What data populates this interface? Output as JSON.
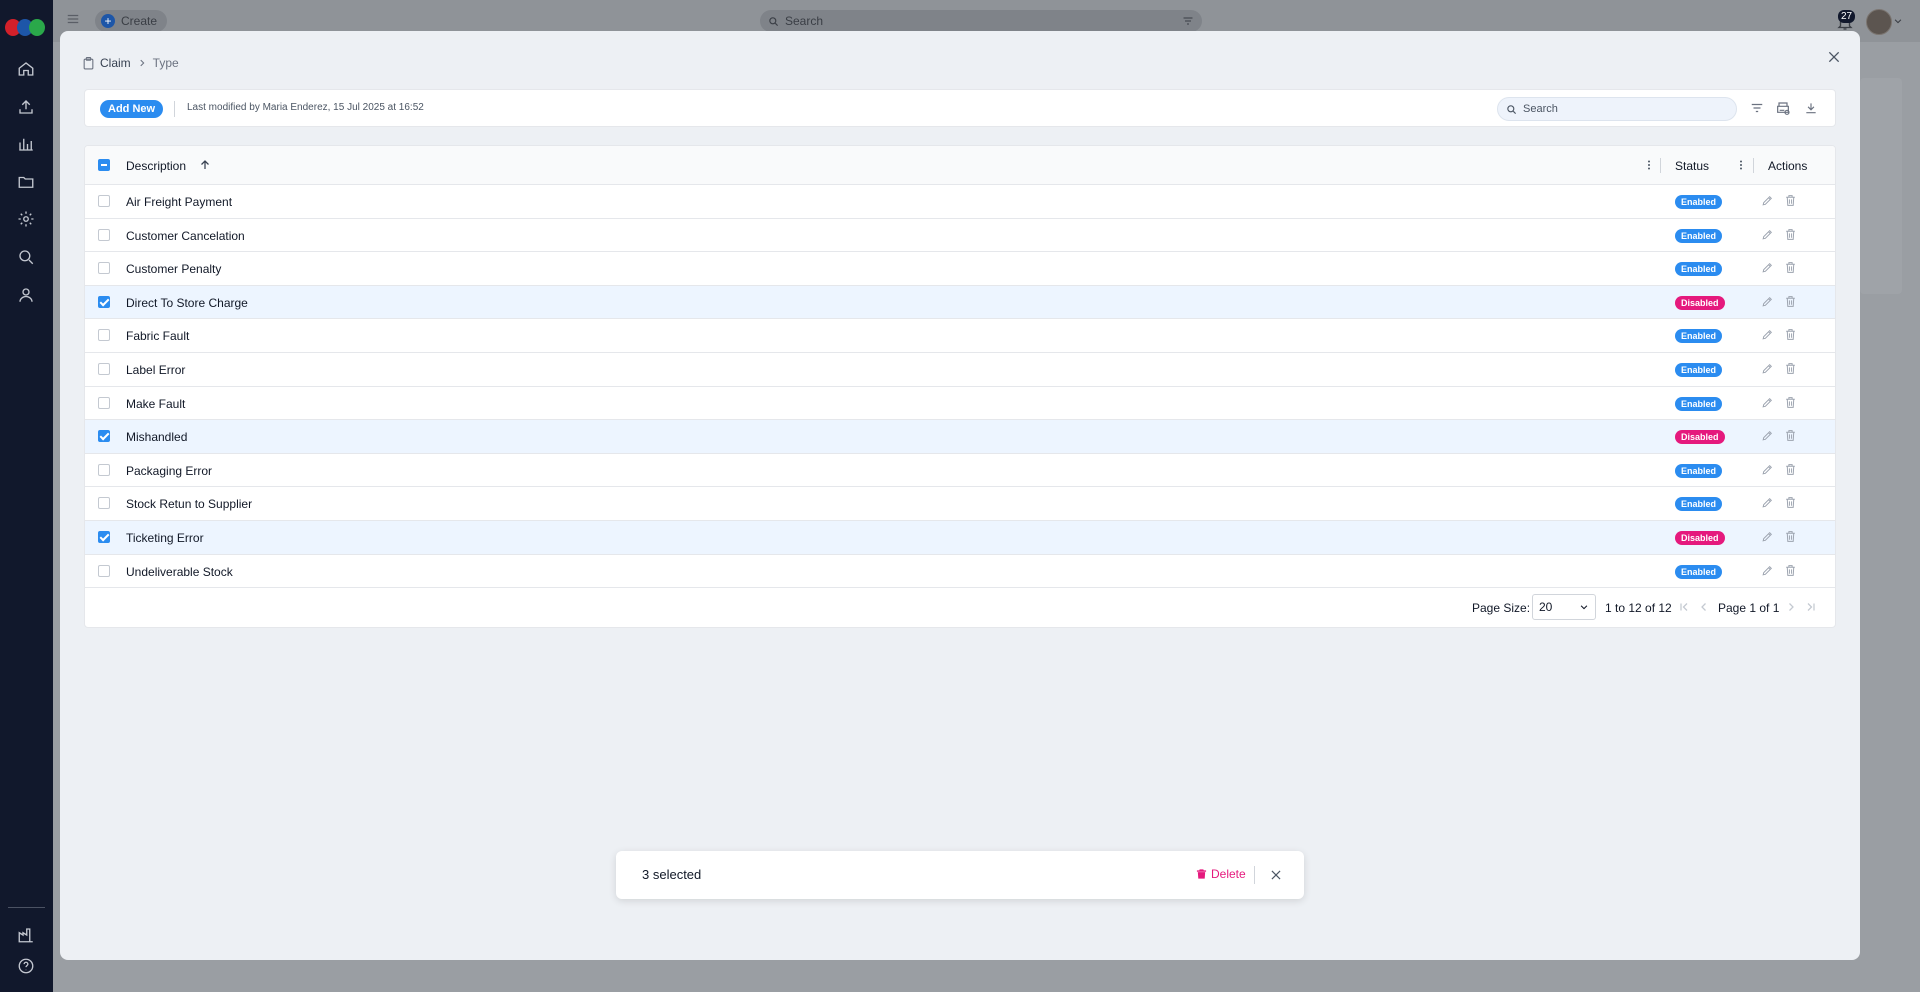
{
  "app": {
    "create_label": "Create",
    "search_placeholder": "Search",
    "notification_count": "27"
  },
  "breadcrumb": {
    "root": "Claim",
    "current": "Type"
  },
  "toolbar": {
    "add_new_label": "Add New",
    "last_modified": "Last modified by Maria Enderez, 15 Jul 2025 at 16:52",
    "search_placeholder": "Search"
  },
  "grid": {
    "columns": {
      "description": "Description",
      "status": "Status",
      "actions": "Actions"
    },
    "rows": [
      {
        "description": "Air Freight Payment",
        "status": "Enabled",
        "selected": false
      },
      {
        "description": "Customer Cancelation",
        "status": "Enabled",
        "selected": false
      },
      {
        "description": "Customer Penalty",
        "status": "Enabled",
        "selected": false
      },
      {
        "description": "Direct To Store Charge",
        "status": "Disabled",
        "selected": true
      },
      {
        "description": "Fabric Fault",
        "status": "Enabled",
        "selected": false
      },
      {
        "description": "Label Error",
        "status": "Enabled",
        "selected": false
      },
      {
        "description": "Make Fault",
        "status": "Enabled",
        "selected": false
      },
      {
        "description": "Mishandled",
        "status": "Disabled",
        "selected": true
      },
      {
        "description": "Packaging Error",
        "status": "Enabled",
        "selected": false
      },
      {
        "description": "Stock Retun to Supplier",
        "status": "Enabled",
        "selected": false
      },
      {
        "description": "Ticketing Error",
        "status": "Disabled",
        "selected": true
      },
      {
        "description": "Undeliverable Stock",
        "status": "Enabled",
        "selected": false
      }
    ]
  },
  "pagination": {
    "page_size_label": "Page Size:",
    "page_size": "20",
    "range": "1 to 12 of 12",
    "page_info": "Page 1 of 1"
  },
  "selection_bar": {
    "count_label": "3 selected",
    "delete_label": "Delete"
  },
  "colors": {
    "accent": "#2b8cf0",
    "enabled_badge": "#2b8cf0",
    "disabled_badge": "#e5197d",
    "rail": "#11182c",
    "selected_row": "#edf5ff"
  },
  "icons": {
    "rail": [
      "home-icon",
      "upload-icon",
      "chart-icon",
      "folder-icon",
      "settings-icon",
      "search-icon",
      "user-icon",
      "factory-icon",
      "help-icon"
    ],
    "toolbar": [
      "filter-icon",
      "print-settings-icon",
      "download-icon"
    ],
    "row_actions": [
      "edit-icon",
      "delete-icon"
    ]
  }
}
